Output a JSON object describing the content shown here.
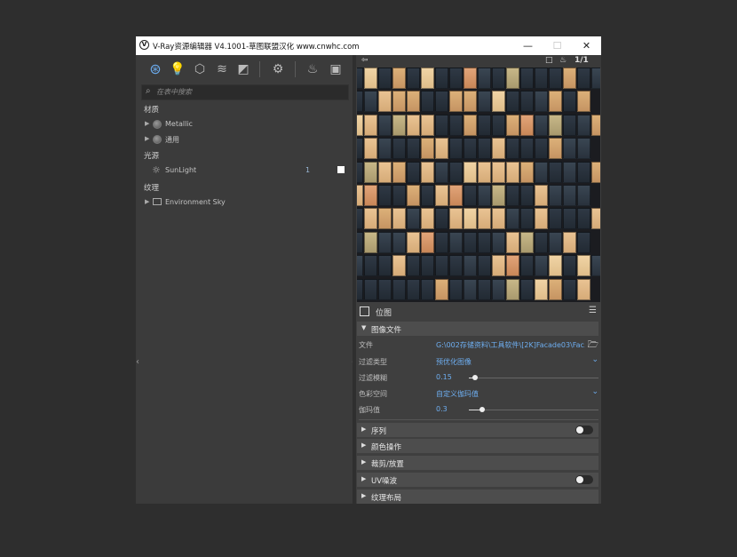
{
  "window": {
    "title": "V-Ray资源编辑器 V4.1001-草图联盟汉化 www.cnwhc.com",
    "logo": "V",
    "controls": {
      "minimize": "—",
      "maximize": "☐",
      "close": "✕"
    }
  },
  "toolbar": {
    "icons": [
      "materials-icon",
      "lights-icon",
      "geometry-icon",
      "layers-icon",
      "textures-icon",
      "settings-icon",
      "render-teapot-icon",
      "frame-buffer-icon"
    ]
  },
  "search": {
    "placeholder": "在表中搜索"
  },
  "tree": {
    "materials": {
      "label": "材质",
      "items": [
        {
          "label": "Metallic"
        },
        {
          "label": "通用"
        }
      ]
    },
    "lights": {
      "label": "光源",
      "items": [
        {
          "label": "SunLight",
          "value": "1"
        }
      ]
    },
    "textures": {
      "label": "纹理",
      "items": [
        {
          "label": "Environment Sky"
        }
      ]
    }
  },
  "preview": {
    "left_icon": "⇦",
    "right_icons": [
      "□",
      "♨",
      "1/1"
    ],
    "colors": {
      "cream": "#e9c393",
      "tan": "#dcb079",
      "dark": "#2f3945",
      "slate": "#3a4653"
    }
  },
  "properties": {
    "type": "位图",
    "sections": {
      "image_file": "图像文件",
      "sequence": "序列",
      "color_ops": "颜色操作",
      "crop_place": "裁剪/放置",
      "uv_noise": "UV噪波",
      "tex_layout": "纹理布局"
    },
    "rows": {
      "file": {
        "label": "文件",
        "value": "G:\\002存储资料\\工具软件\\[2K]Facade03\\Fac..."
      },
      "filter_type": {
        "label": "过滤类型",
        "value": "预优化图像"
      },
      "filter_blur": {
        "label": "过滤模糊",
        "value": "0.15",
        "slider": 0.05
      },
      "color_space": {
        "label": "色彩空间",
        "value": "自定义伽玛值"
      },
      "gamma": {
        "label": "伽玛值",
        "value": "0.3",
        "slider": 0.1
      }
    },
    "toggles": {
      "sequence": false,
      "uv_noise": false
    },
    "accent": "#6eaef0"
  }
}
